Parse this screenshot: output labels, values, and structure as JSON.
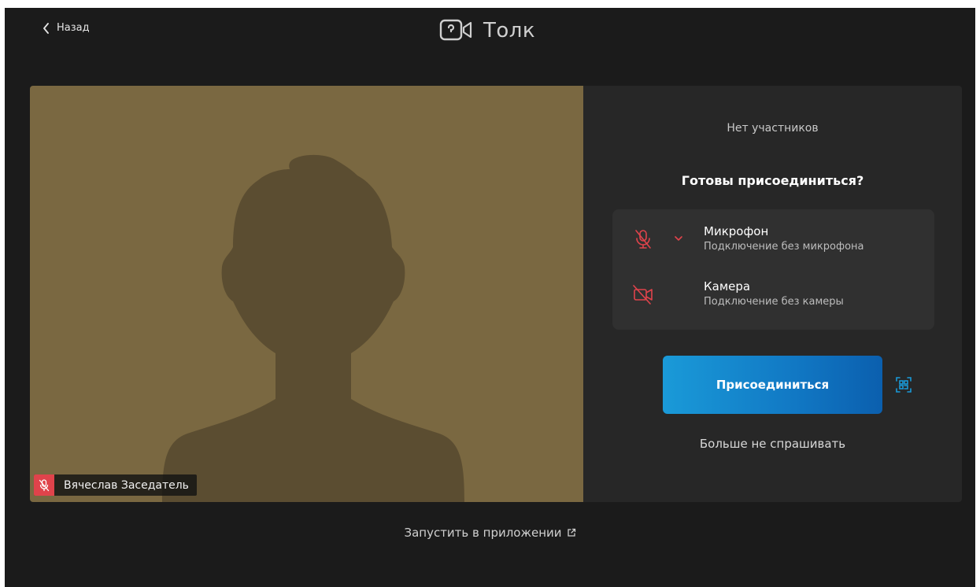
{
  "header": {
    "back_label": "Назад",
    "app_name": "Толк"
  },
  "video": {
    "participant_name": "Вячеслав Заседатель",
    "background_color": "#7a6841",
    "silhouette_color": "#5b4d31",
    "mic_badge_color": "#e0434b"
  },
  "panel": {
    "no_participants": "Нет участников",
    "ready_title": "Готовы присоединиться?",
    "microphone": {
      "title": "Микрофон",
      "subtitle": "Подключение без микрофона",
      "icon": "mic-off-icon"
    },
    "camera": {
      "title": "Камера",
      "subtitle": "Подключение без камеры",
      "icon": "camera-off-icon"
    },
    "join_button": "Присоединиться",
    "dont_ask": "Больше не спрашивать"
  },
  "footer": {
    "launch_app": "Запустить в приложении",
    "launch_icon": "external-link-icon"
  },
  "colors": {
    "background": "#1b1b1b",
    "panel": "#272727",
    "device_box": "#303030",
    "accent_red": "#e0434b",
    "join_gradient_start": "#1a9ad8",
    "join_gradient_end": "#0b5fae"
  }
}
